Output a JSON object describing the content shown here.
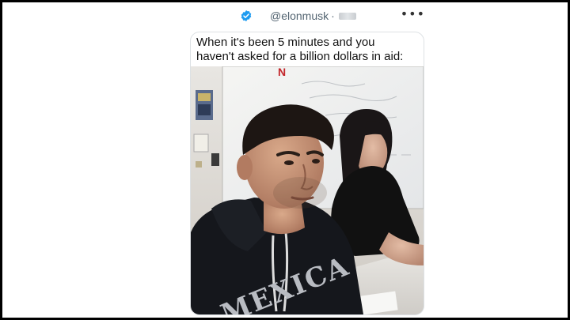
{
  "post": {
    "handle": "@elonmusk",
    "separator": "·",
    "more_label": "•••",
    "verified_badge_icon": "verified-check-icon",
    "accent_color": "#1d9bf0"
  },
  "meme": {
    "caption_line1": "When it's been 5 minutes and you",
    "caption_line2": "haven't asked for a billion dollars in aid:",
    "shirt_text": "MEXICA"
  }
}
